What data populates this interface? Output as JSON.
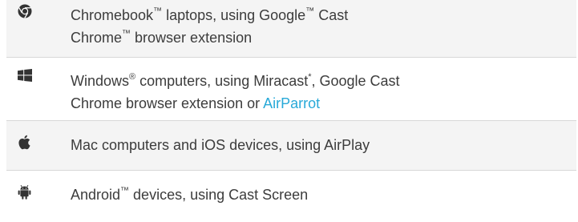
{
  "colors": {
    "text": "#3c3c3c",
    "link": "#28a9d8",
    "row_shade": "#f4f4f4",
    "divider": "#d8d8d8",
    "icon": "#333333"
  },
  "rows": [
    {
      "icon": "chrome-icon",
      "line1_a": "Chromebook",
      "line1_tm1": "™",
      "line1_b": " laptops, using Google",
      "line1_tm2": "™",
      "line1_c": " Cast",
      "line2_a": "Chrome",
      "line2_tm": "™",
      "line2_b": " browser extension"
    },
    {
      "icon": "windows-icon",
      "line1_a": "Windows",
      "line1_reg": "®",
      "line1_b": " computers, using Miracast",
      "line1_star": "*",
      "line1_c": ", Google Cast",
      "line2_a": "Chrome browser extension or ",
      "line2_link": "AirParrot"
    },
    {
      "icon": "apple-icon",
      "line1": "Mac computers and iOS devices, using AirPlay"
    },
    {
      "icon": "android-icon",
      "line1_a": "Android",
      "line1_tm": "™",
      "line1_b": " devices, using Cast Screen"
    }
  ]
}
